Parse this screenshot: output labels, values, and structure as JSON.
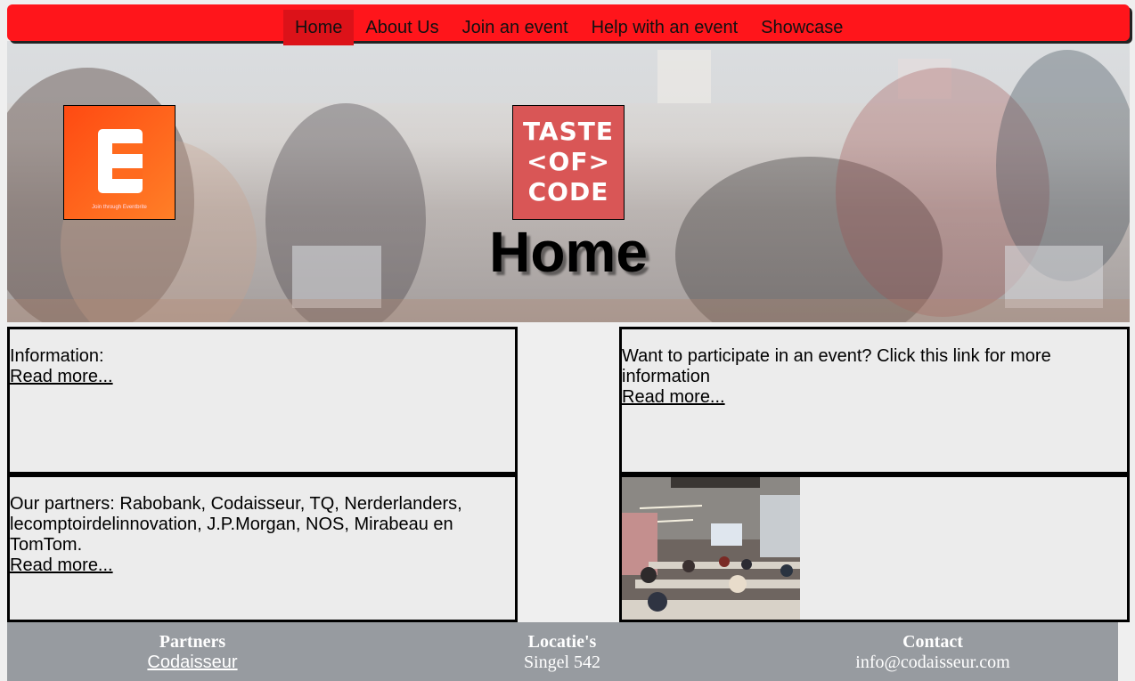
{
  "nav": {
    "items": [
      {
        "label": "Home",
        "active": true
      },
      {
        "label": "About Us"
      },
      {
        "label": "Join an event"
      },
      {
        "label": "Help with an event"
      },
      {
        "label": "Showcase"
      }
    ]
  },
  "hero": {
    "title": "Home",
    "eventbrite_logo": {
      "letter": "E",
      "caption": "Join through Eventbrite"
    },
    "toc_logo": {
      "line1": "TASTE",
      "line2": "<OF>",
      "line3": "CODE"
    }
  },
  "panels": {
    "info": {
      "text": "Information:",
      "link": "Read more..."
    },
    "participate": {
      "text": "Want to participate in an event? Click this link for more information",
      "link": "Read more..."
    },
    "partners": {
      "text": "Our partners: Rabobank, Codaisseur, TQ, Nerderlanders, lecomptoirdelinnovation, J.P.Morgan, NOS, Mirabeau en TomTom.",
      "link": "Read more..."
    }
  },
  "footer": {
    "partners": {
      "heading": "Partners",
      "link": "Codaisseur"
    },
    "locations": {
      "heading": "Locatie's",
      "value": "Singel 542"
    },
    "contact": {
      "heading": "Contact",
      "value": "info@codaisseur.com"
    }
  },
  "colors": {
    "nav_bg": "#ff151b",
    "nav_active": "#dc1219",
    "footer_bg": "#979ba0",
    "panel_bg": "#ececec"
  }
}
